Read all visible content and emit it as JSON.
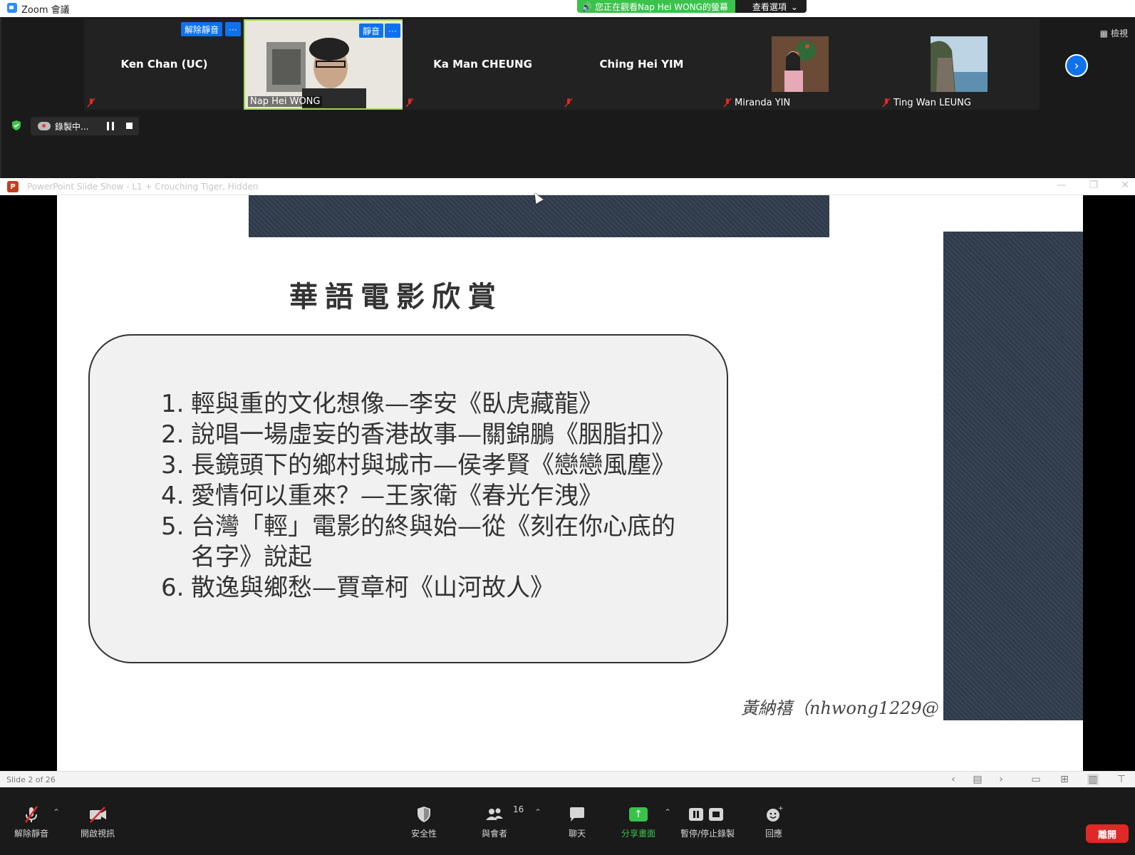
{
  "window": {
    "title": "Zoom 會議"
  },
  "banner": {
    "viewing": "您正在觀看Nap Hei WONG的螢幕",
    "view_options": "查看選項"
  },
  "gallery": {
    "view_label": "檢視",
    "participants": [
      {
        "name": "Ken Chan (UC)",
        "unmute_label": "解除靜音",
        "more_label": "···"
      },
      {
        "name": "Nap Hei WONG",
        "mute_label": "靜音",
        "more_label": "···"
      },
      {
        "name": "Ka Man CHEUNG"
      },
      {
        "name": "Ching Hei YIM"
      },
      {
        "name": "Miranda YIN"
      },
      {
        "name": "Ting Wan LEUNG"
      }
    ],
    "next_label": "›"
  },
  "recording": {
    "label": "錄製中..."
  },
  "ppt": {
    "window_title": "PowerPoint Slide Show  -  L1 + Crouching Tiger, Hidden",
    "window_controls": [
      "—",
      "❐",
      "✕"
    ],
    "slide_status": "Slide 2 of 26"
  },
  "slide": {
    "title": "華語電影欣賞",
    "topics": [
      {
        "num": "1.",
        "text": "輕與重的文化想像—李安《臥虎藏龍》"
      },
      {
        "num": "2.",
        "text": "說唱一場虛妄的香港故事—關錦鵬《胭脂扣》"
      },
      {
        "num": "3.",
        "text": "長鏡頭下的鄉村與城市—侯孝賢《戀戀風塵》"
      },
      {
        "num": "4.",
        "text": "愛情何以重來？—王家衛《春光乍洩》"
      },
      {
        "num": "5.",
        "text": "台灣「輕」電影的終與始—從《刻在你心底的名字》說起"
      },
      {
        "num": "6.",
        "text": "散逸與鄉愁—賈章柯《山河故人》"
      }
    ],
    "footer": "黃納禧（nhwong1229@"
  },
  "toolbar": {
    "unmute": "解除靜音",
    "start_video": "開啟視訊",
    "security": "安全性",
    "participants": "與會者",
    "participants_count": "16",
    "chat": "聊天",
    "share_screen": "分享畫面",
    "pause_stop_recording": "暫停/停止錄製",
    "reactions": "回應",
    "leave": "離開"
  },
  "colors": {
    "zoom_blue": "#0e72ed",
    "banner_green": "#3ac24a",
    "leave_red": "#e02828",
    "active_border": "#a3d84b"
  }
}
